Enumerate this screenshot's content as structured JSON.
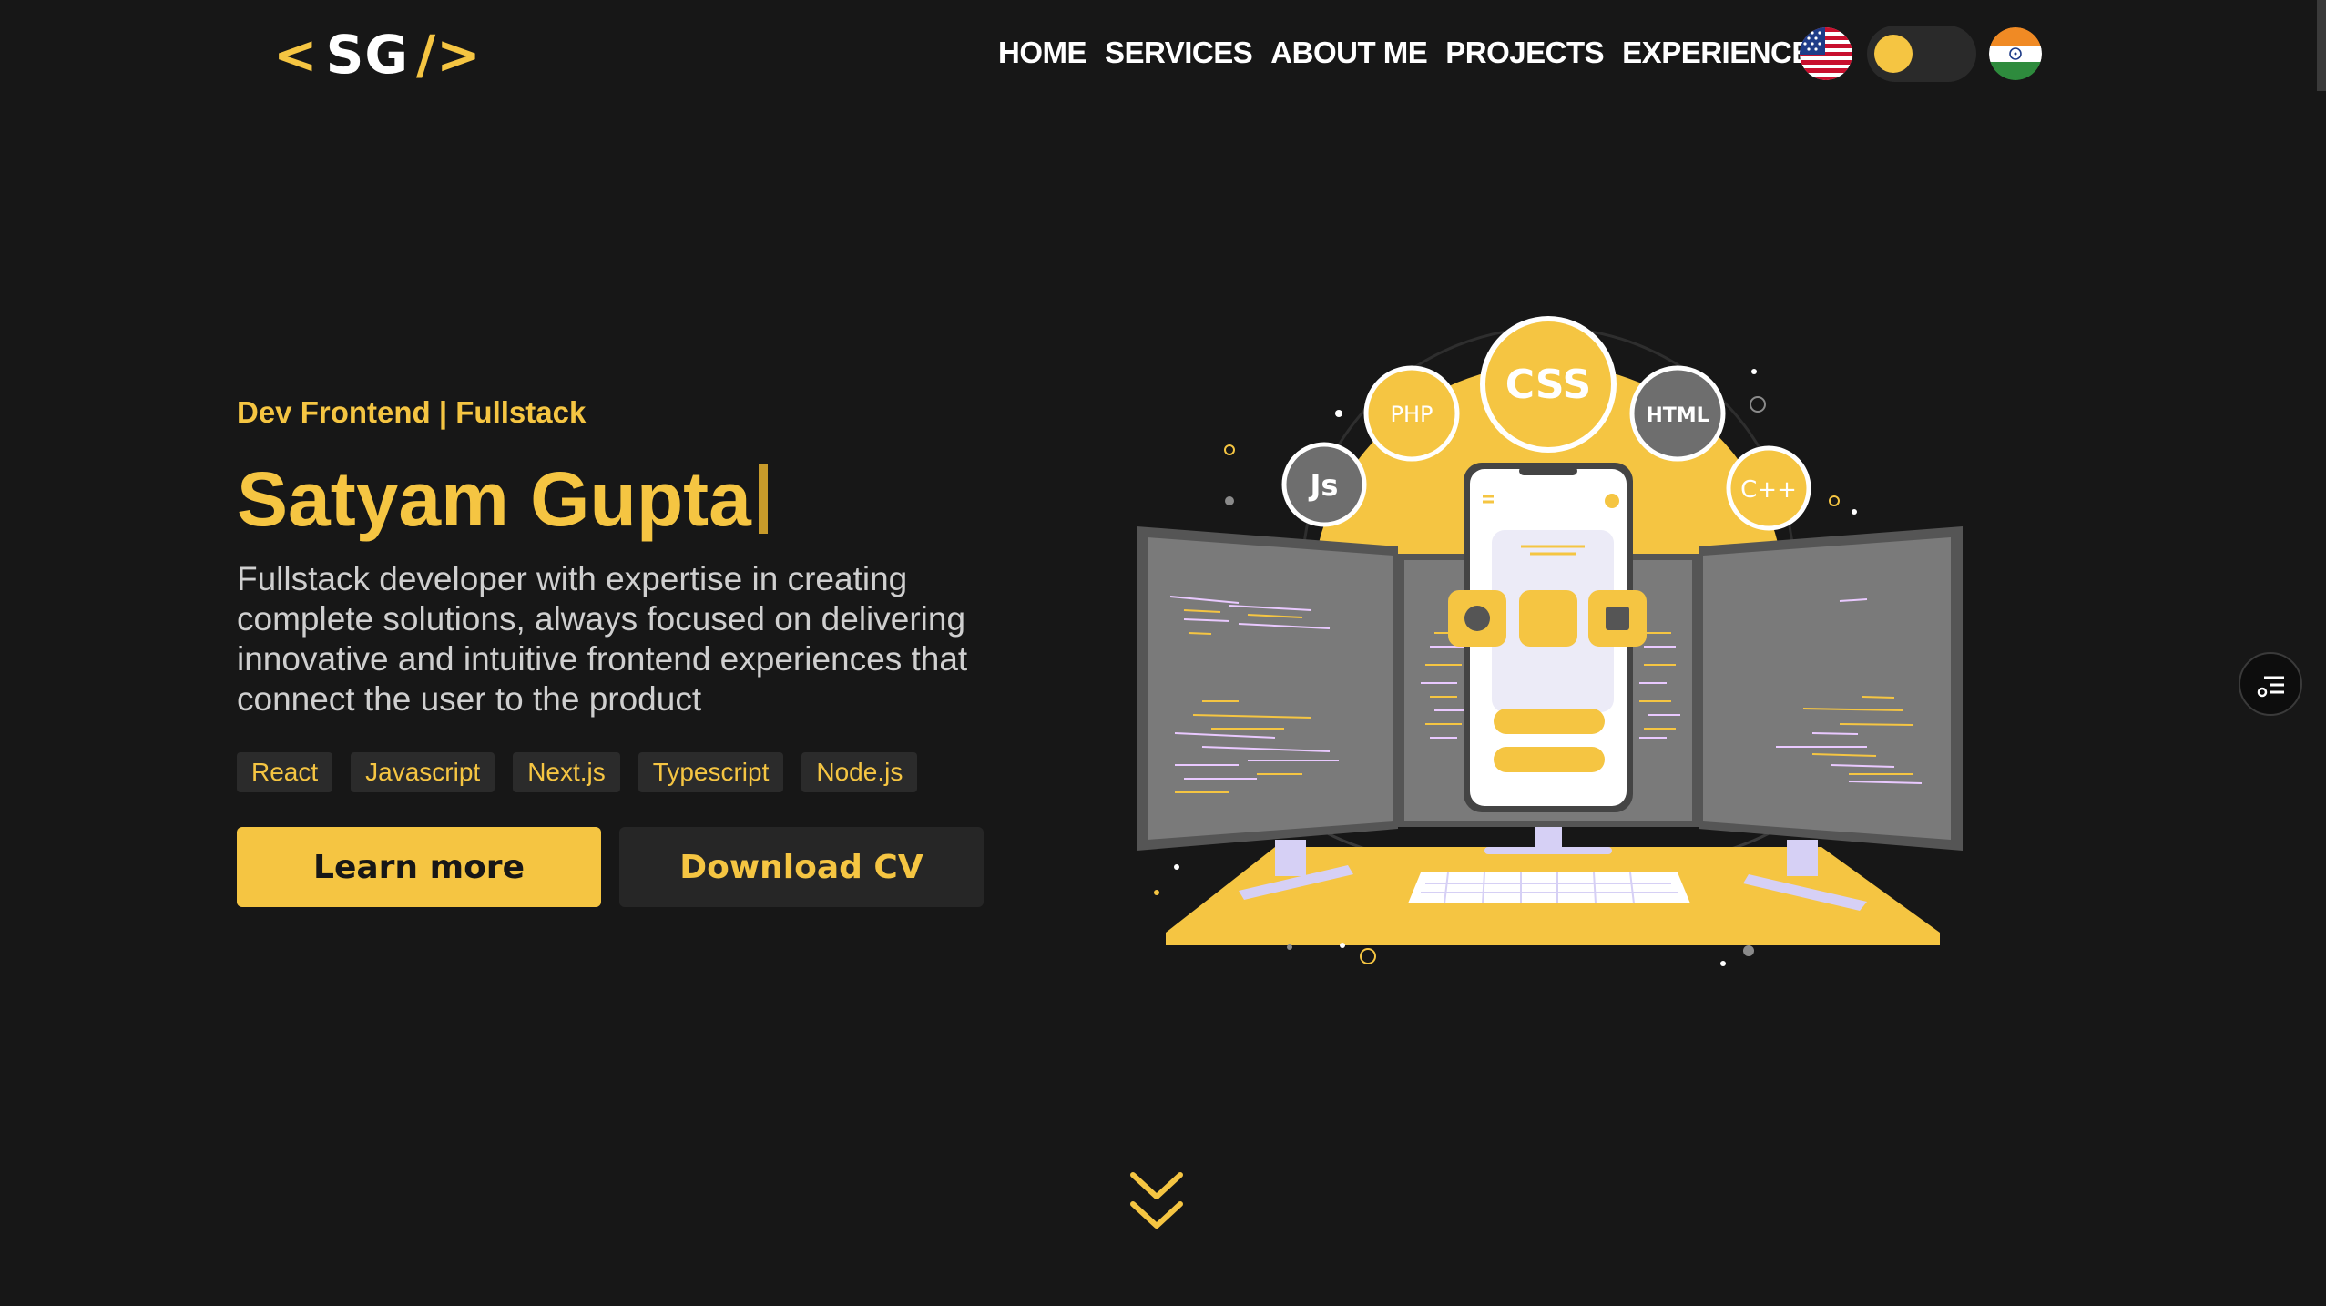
{
  "logo": {
    "open": "<",
    "initials": "SG",
    "close": "/>"
  },
  "nav": {
    "items": [
      {
        "label": "HOME"
      },
      {
        "label": "SERVICES"
      },
      {
        "label": "ABOUT ME"
      },
      {
        "label": "PROJECTS"
      },
      {
        "label": "EXPERIENCE"
      }
    ]
  },
  "controls": {
    "language_left": "us-flag-icon",
    "language_right": "india-flag-icon",
    "theme_toggle": "theme-toggle"
  },
  "hero": {
    "role": "Dev Frontend | Fullstack",
    "name": "Satyam Gupta",
    "description": "Fullstack developer with expertise in creating complete solutions, always focused on delivering innovative and intuitive frontend experiences that connect the user to the product",
    "tags": [
      "React",
      "Javascript",
      "Next.js",
      "Typescript",
      "Node.js"
    ],
    "primary_button": "Learn more",
    "secondary_button": "Download CV"
  },
  "illustration": {
    "bubbles": [
      "Js",
      "PHP",
      "CSS",
      "HTML",
      "C++"
    ]
  },
  "colors": {
    "accent": "#f5c542",
    "background": "#171717",
    "surface": "#2b2b2b"
  }
}
